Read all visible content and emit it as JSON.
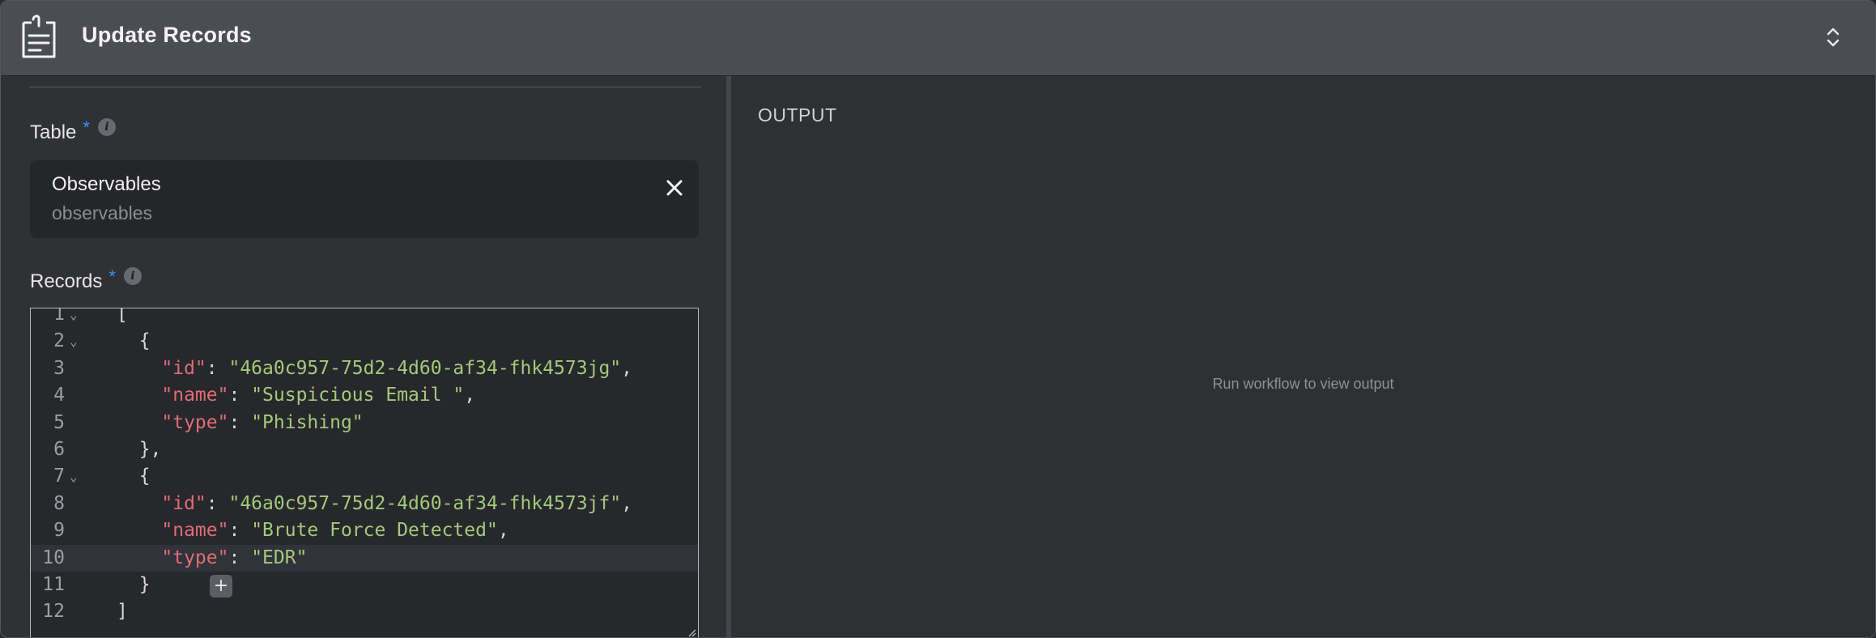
{
  "header": {
    "title": "Update Records",
    "icon": "clipboard-list-icon"
  },
  "table_field": {
    "label": "Table",
    "required_mark": "*",
    "info": "i",
    "selected_name": "Observables",
    "selected_id": "observables"
  },
  "records_field": {
    "label": "Records",
    "required_mark": "*",
    "info": "i"
  },
  "editor": {
    "lines": [
      {
        "n": "1",
        "fold": true,
        "parts": [
          [
            "p",
            "["
          ]
        ]
      },
      {
        "n": "2",
        "fold": true,
        "parts": [
          [
            "p",
            "  {"
          ]
        ]
      },
      {
        "n": "3",
        "fold": false,
        "parts": [
          [
            "p",
            "    "
          ],
          [
            "k",
            "\"id\""
          ],
          [
            "p",
            ": "
          ],
          [
            "s",
            "\"46a0c957-75d2-4d60-af34-fhk4573jg\""
          ],
          [
            "p",
            ","
          ]
        ]
      },
      {
        "n": "4",
        "fold": false,
        "parts": [
          [
            "p",
            "    "
          ],
          [
            "k",
            "\"name\""
          ],
          [
            "p",
            ": "
          ],
          [
            "s",
            "\"Suspicious Email \""
          ],
          [
            "p",
            ","
          ]
        ]
      },
      {
        "n": "5",
        "fold": false,
        "parts": [
          [
            "p",
            "    "
          ],
          [
            "k",
            "\"type\""
          ],
          [
            "p",
            ": "
          ],
          [
            "s",
            "\"Phishing\""
          ]
        ]
      },
      {
        "n": "6",
        "fold": false,
        "parts": [
          [
            "p",
            "  },"
          ]
        ]
      },
      {
        "n": "7",
        "fold": true,
        "parts": [
          [
            "p",
            "  {"
          ]
        ]
      },
      {
        "n": "8",
        "fold": false,
        "parts": [
          [
            "p",
            "    "
          ],
          [
            "k",
            "\"id\""
          ],
          [
            "p",
            ": "
          ],
          [
            "s",
            "\"46a0c957-75d2-4d60-af34-fhk4573jf\""
          ],
          [
            "p",
            ","
          ]
        ]
      },
      {
        "n": "9",
        "fold": false,
        "parts": [
          [
            "p",
            "    "
          ],
          [
            "k",
            "\"name\""
          ],
          [
            "p",
            ": "
          ],
          [
            "s",
            "\"Brute Force Detected\""
          ],
          [
            "p",
            ","
          ]
        ]
      },
      {
        "n": "10",
        "fold": false,
        "active": true,
        "parts": [
          [
            "p",
            "    "
          ],
          [
            "k",
            "\"type\""
          ],
          [
            "p",
            ": "
          ],
          [
            "s",
            "\"EDR\""
          ]
        ]
      },
      {
        "n": "11",
        "fold": false,
        "parts": [
          [
            "p",
            "  }"
          ]
        ]
      },
      {
        "n": "12",
        "fold": false,
        "parts": [
          [
            "p",
            "]"
          ]
        ]
      }
    ],
    "add_button": "+"
  },
  "output": {
    "title": "OUTPUT",
    "empty_message": "Run workflow to view output"
  },
  "colors": {
    "accent": "#3b8ff5",
    "json_key": "#e06c75",
    "json_string": "#a3c97a"
  }
}
